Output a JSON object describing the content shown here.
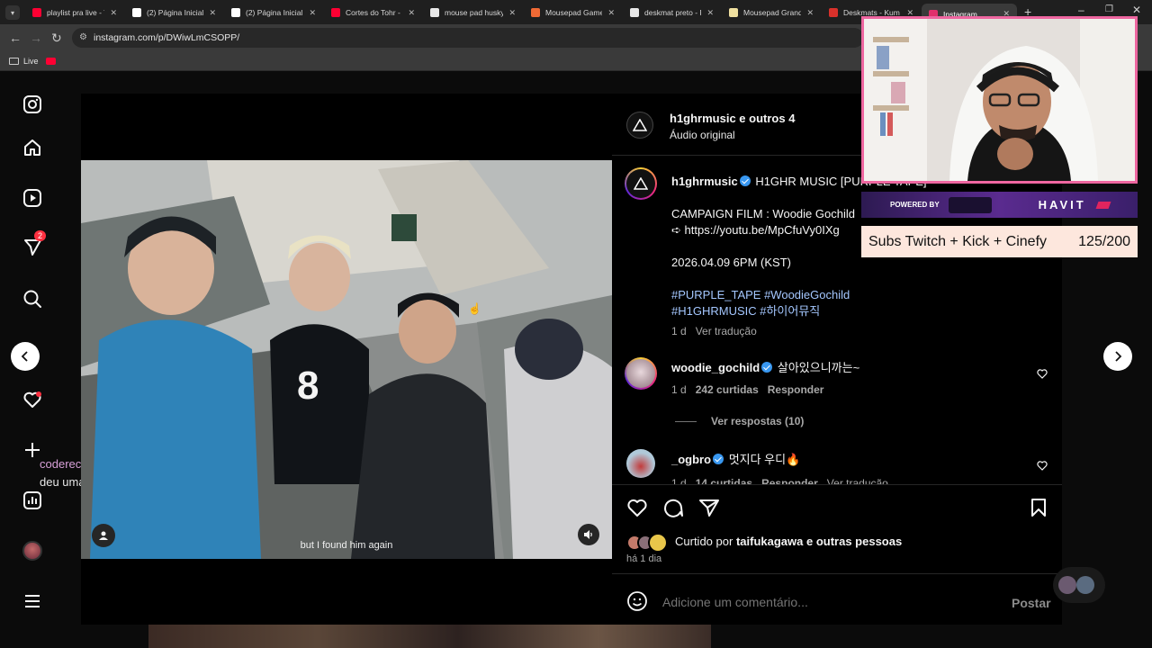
{
  "tabs": [
    {
      "label": "playlist pra live - Y",
      "favicon_color": "#ff0033"
    },
    {
      "label": "(2) Página Inicial / ",
      "favicon_color": "#ffffff"
    },
    {
      "label": "(2) Página Inicial / ",
      "favicon_color": "#ffffff"
    },
    {
      "label": "Cortes do Tohr - Y",
      "favicon_color": "#ff0033"
    },
    {
      "label": "mouse pad husky",
      "favicon_color": "#e8e8e8"
    },
    {
      "label": "Mousepad Gamer",
      "favicon_color": "#f06a35"
    },
    {
      "label": "deskmat preto - P",
      "favicon_color": "#e8e8e8"
    },
    {
      "label": "Mousepad Grand",
      "favicon_color": "#f0e0a0"
    },
    {
      "label": "Deskmats - Kum",
      "favicon_color": "#d9312b"
    },
    {
      "label": "Instagram",
      "favicon_color": "#e1306c",
      "active": true
    }
  ],
  "address": {
    "url": "instagram.com/p/DWiwLmCSOPP/"
  },
  "bookmarks": {
    "folder": "Live"
  },
  "side_overlay": {
    "user": "coderecast",
    "message": "deu uma de brasil"
  },
  "nav": {
    "notification_badge": "2"
  },
  "video": {
    "subtitle": "but I found him again"
  },
  "post": {
    "header_user": "h1ghrmusic e outros 4",
    "header_audio": "Áudio original",
    "caption_user": "h1ghrmusic",
    "caption_title": "H1GHR MUSIC [PURPLE TAPE]",
    "caption_line1": "CAMPAIGN FILM : Woodie Gochild",
    "caption_line2": "➪ https://youtu.be/MpCfuVy0IXg",
    "caption_date": "2026.04.09 6PM (KST)",
    "hashtags_line1": "#PURPLE_TAPE #WoodieGochild",
    "hashtags_line2": "#H1GHRMUSIC #하이어뮤직",
    "caption_time": "1 d",
    "caption_translate": "Ver tradução"
  },
  "comments": [
    {
      "user": "woodie_gochild",
      "text": "살아있으니까는~",
      "time": "1 d",
      "likes": "242 curtidas",
      "reply": "Responder",
      "view_replies": "Ver respostas (10)"
    },
    {
      "user": "_ogbro",
      "text": "멋지다 우디🔥",
      "time": "1 d",
      "likes": "14 curtidas",
      "reply": "Responder",
      "translate": "Ver tradução"
    }
  ],
  "likes": {
    "prefix": "Curtido por",
    "user": "taifukagawa",
    "suffix": "e outras pessoas",
    "time": "há 1 dia"
  },
  "comment_box": {
    "placeholder": "Adicione um comentário...",
    "post_label": "Postar"
  },
  "overlay": {
    "sponsor_powered": "POWERED BY",
    "sponsor_brand": "HAVIT",
    "goal_label": "Subs Twitch + Kick + Cinefy",
    "goal_count": "125/200"
  }
}
